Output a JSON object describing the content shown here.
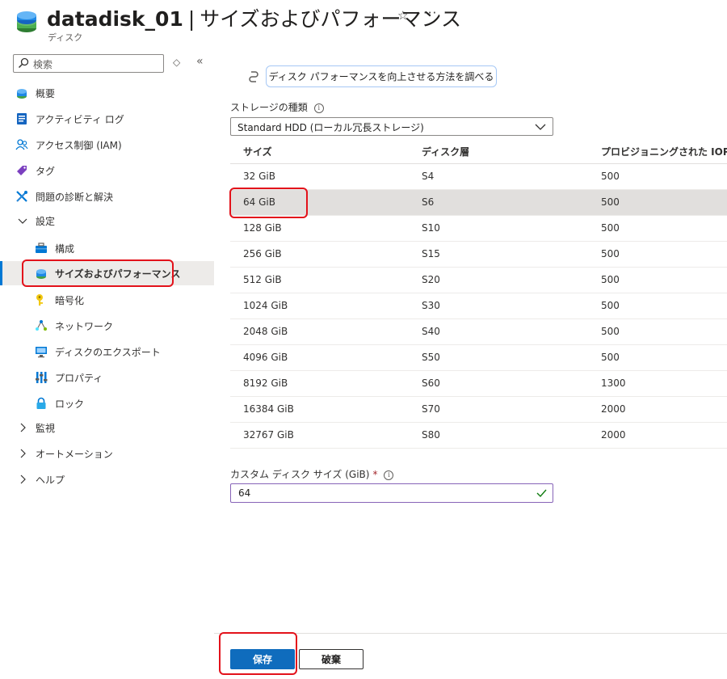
{
  "header": {
    "resource_name": "datadisk_01",
    "separator": "|",
    "page_title": "サイズおよびパフォーマンス",
    "resource_type": "ディスク",
    "favorite_icon": "star-icon",
    "more_icon": "more-icon"
  },
  "sidebar": {
    "search_placeholder": "検索",
    "items": [
      {
        "label": "概要",
        "icon": "disk-icon"
      },
      {
        "label": "アクティビティ ログ",
        "icon": "activity-log-icon"
      },
      {
        "label": "アクセス制御 (IAM)",
        "icon": "people-icon"
      },
      {
        "label": "タグ",
        "icon": "tag-icon"
      },
      {
        "label": "問題の診断と解決",
        "icon": "wrench-icon"
      },
      {
        "label": "設定",
        "icon": "chevron-down-icon",
        "expanded": true
      },
      {
        "label": "構成",
        "icon": "toolbox-icon"
      },
      {
        "label": "サイズおよびパフォーマンス",
        "icon": "disk-icon",
        "selected": true
      },
      {
        "label": "暗号化",
        "icon": "key-icon"
      },
      {
        "label": "ネットワーク",
        "icon": "network-icon"
      },
      {
        "label": "ディスクのエクスポート",
        "icon": "monitor-export-icon"
      },
      {
        "label": "プロパティ",
        "icon": "properties-icon"
      },
      {
        "label": "ロック",
        "icon": "lock-icon"
      },
      {
        "label": "監視",
        "icon": "chevron-right-icon"
      },
      {
        "label": "オートメーション",
        "icon": "chevron-right-icon"
      },
      {
        "label": "ヘルプ",
        "icon": "chevron-right-icon"
      }
    ]
  },
  "main": {
    "tip_button_label": "ディスク パフォーマンスを向上させる方法を調べる",
    "storage_type_label": "ストレージの種類",
    "storage_type_value": "Standard HDD (ローカル冗長ストレージ)",
    "table": {
      "headers": [
        "サイズ",
        "ディスク層",
        "プロビジョニングされた IOPS"
      ],
      "rows": [
        [
          "32 GiB",
          "S4",
          "500"
        ],
        [
          "64 GiB",
          "S6",
          "500"
        ],
        [
          "128 GiB",
          "S10",
          "500"
        ],
        [
          "256 GiB",
          "S15",
          "500"
        ],
        [
          "512 GiB",
          "S20",
          "500"
        ],
        [
          "1024 GiB",
          "S30",
          "500"
        ],
        [
          "2048 GiB",
          "S40",
          "500"
        ],
        [
          "4096 GiB",
          "S50",
          "500"
        ],
        [
          "8192 GiB",
          "S60",
          "1300"
        ],
        [
          "16384 GiB",
          "S70",
          "2000"
        ],
        [
          "32767 GiB",
          "S80",
          "2000"
        ]
      ],
      "selected_row": 1
    },
    "custom_size_label": "カスタム ディスク サイズ (GiB)",
    "required_mark": "*",
    "custom_size_value": "64"
  },
  "footer": {
    "save_label": "保存",
    "discard_label": "破棄"
  },
  "colors": {
    "accent": "#0f6cbd",
    "highlight": "#e3121b",
    "selected_row": "#e1dfdd"
  }
}
